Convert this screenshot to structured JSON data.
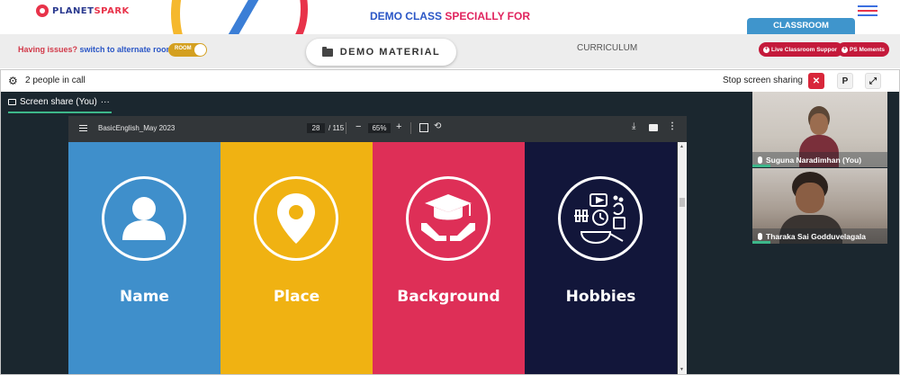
{
  "header": {
    "logo_text_a": "PLANET",
    "logo_text_b": "SPARK",
    "title_part1": "DEMO CLASS",
    "title_part2": "SPECIALLY FOR",
    "classroom_tab": "CLASSROOM"
  },
  "subheader": {
    "issues_question": "Having issues?",
    "issues_action": "switch to alternate room",
    "toggle_label": "ROOM",
    "demo_material": "DEMO MATERIAL",
    "curriculum": "CURRICULUM",
    "live_support": "Live Classroom Support",
    "ps_moments": "PS Moments"
  },
  "call": {
    "people_count": "2 people in call",
    "stop_sharing": "Stop screen sharing",
    "p_button": "P",
    "close_glyph": "✕",
    "expand_glyph": "⤢"
  },
  "share": {
    "tab_label": "Screen share (You)",
    "tab_more": "···"
  },
  "pdf": {
    "filename": "BasicEnglish_May 2023",
    "page_current": "28",
    "page_total": "/ 115",
    "zoom": "65%",
    "zoom_minus": "−",
    "zoom_plus": "+",
    "panels": [
      {
        "label": "Name",
        "color": "#3f8fcb",
        "icon": "person-icon"
      },
      {
        "label": "Place",
        "color": "#f0b212",
        "icon": "location-pin-icon"
      },
      {
        "label": "Background",
        "color": "#de2f57",
        "icon": "graduation-cap-icon"
      },
      {
        "label": "Hobbies",
        "color": "#12163a",
        "icon": "hobbies-icon"
      }
    ]
  },
  "participants": [
    {
      "name": "Suguna Naradimhan (You)"
    },
    {
      "name": "Tharaka Sai Godduvelagala"
    }
  ],
  "colors": {
    "accent_blue": "#2a56c6",
    "accent_pink": "#e0245e",
    "classroom_tab": "#3f95cc",
    "pill_red": "#c41a3b",
    "stop_red": "#d8263a",
    "share_bg": "#1b272f",
    "active_green": "#3db78a"
  }
}
